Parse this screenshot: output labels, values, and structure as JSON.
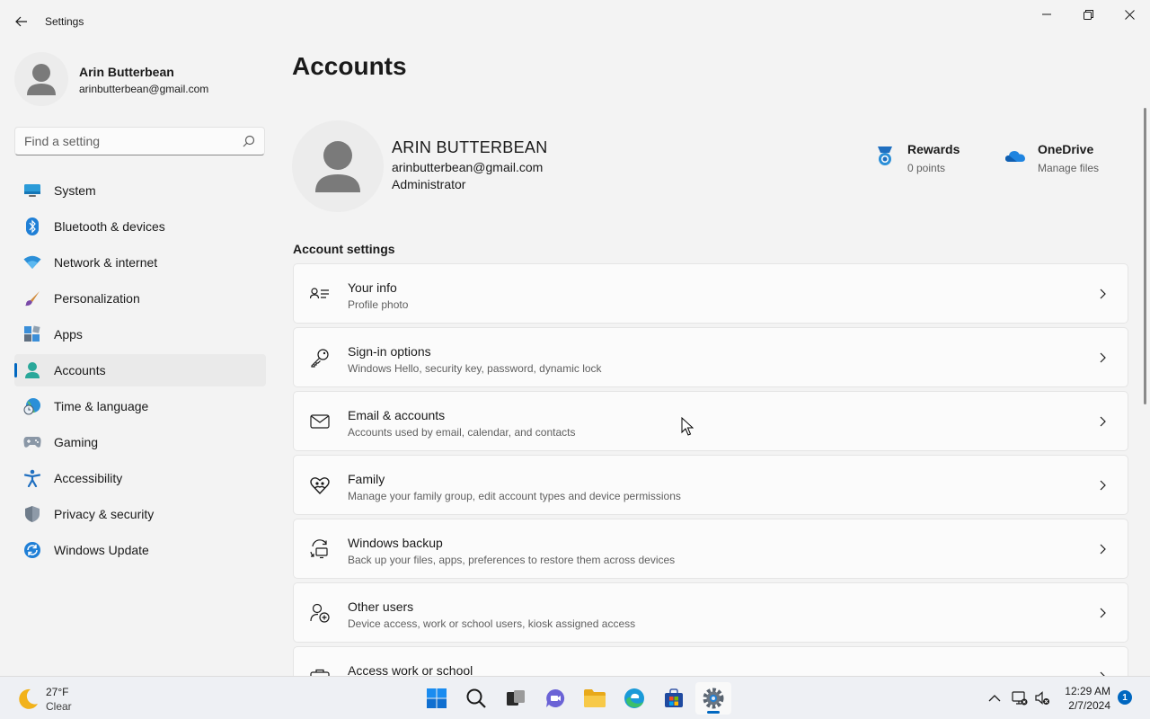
{
  "window": {
    "title": "Settings"
  },
  "profile": {
    "name": "Arin Butterbean",
    "email": "arinbutterbean@gmail.com"
  },
  "search": {
    "placeholder": "Find a setting"
  },
  "nav": [
    {
      "label": "System",
      "icon": "monitor-icon"
    },
    {
      "label": "Bluetooth & devices",
      "icon": "bluetooth-icon"
    },
    {
      "label": "Network & internet",
      "icon": "wifi-icon"
    },
    {
      "label": "Personalization",
      "icon": "brush-icon"
    },
    {
      "label": "Apps",
      "icon": "apps-icon"
    },
    {
      "label": "Accounts",
      "icon": "person-icon",
      "active": true
    },
    {
      "label": "Time & language",
      "icon": "globe-clock-icon"
    },
    {
      "label": "Gaming",
      "icon": "gamepad-icon"
    },
    {
      "label": "Accessibility",
      "icon": "accessibility-icon"
    },
    {
      "label": "Privacy & security",
      "icon": "shield-icon"
    },
    {
      "label": "Windows Update",
      "icon": "update-icon"
    }
  ],
  "main": {
    "title": "Accounts",
    "hero": {
      "name": "ARIN BUTTERBEAN",
      "email": "arinbutterbean@gmail.com",
      "role": "Administrator"
    },
    "tiles": {
      "rewards": {
        "title": "Rewards",
        "subtitle": "0 points"
      },
      "onedrive": {
        "title": "OneDrive",
        "subtitle": "Manage files"
      }
    },
    "section_title": "Account settings",
    "rows": [
      {
        "title": "Your info",
        "subtitle": "Profile photo",
        "icon": "person-card-icon"
      },
      {
        "title": "Sign-in options",
        "subtitle": "Windows Hello, security key, password, dynamic lock",
        "icon": "key-icon"
      },
      {
        "title": "Email & accounts",
        "subtitle": "Accounts used by email, calendar, and contacts",
        "icon": "mail-icon"
      },
      {
        "title": "Family",
        "subtitle": "Manage your family group, edit account types and device permissions",
        "icon": "family-heart-icon"
      },
      {
        "title": "Windows backup",
        "subtitle": "Back up your files, apps, preferences to restore them across devices",
        "icon": "backup-icon"
      },
      {
        "title": "Other users",
        "subtitle": "Device access, work or school users, kiosk assigned access",
        "icon": "add-person-icon"
      },
      {
        "title": "Access work or school",
        "subtitle": "",
        "icon": "briefcase-icon"
      }
    ]
  },
  "taskbar": {
    "weather": {
      "temp": "27°F",
      "condition": "Clear"
    },
    "clock": {
      "time": "12:29 AM",
      "date": "2/7/2024"
    },
    "notification_count": "1",
    "accent": "#0067c0"
  }
}
